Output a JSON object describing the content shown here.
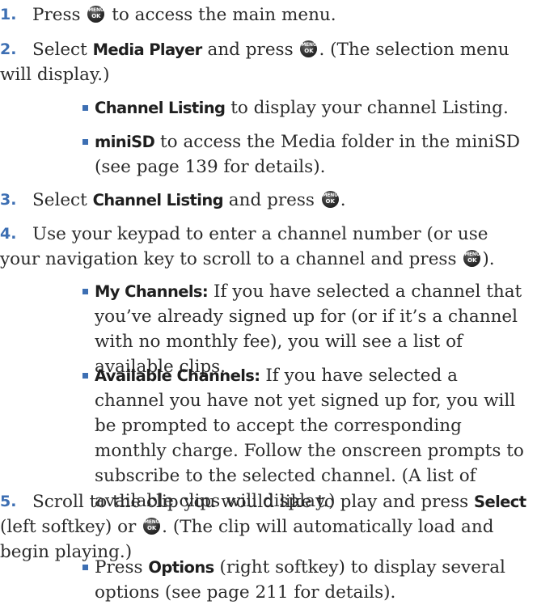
{
  "menu_key": {
    "top": "MENU",
    "bottom": "OK"
  },
  "steps": [
    {
      "num": "1.",
      "a": "Press ",
      "b": " to access the main menu."
    },
    {
      "num": "2.",
      "a": "Select ",
      "bold1": "Media Player",
      "b": " and press ",
      "c": ". (The selection menu will display.)"
    },
    {
      "num": "3.",
      "a": "Select ",
      "bold1": "Channel Listing",
      "b": " and press ",
      "c": "."
    },
    {
      "num": "4.",
      "a": "Use your keypad to enter a channel number (or use your navigation key to scroll to a channel and press ",
      "b": ")."
    },
    {
      "num": "5.",
      "a": "Scroll to the clip you would like to play and press ",
      "bold1": "Select",
      "b": " (left softkey) or ",
      "c": ". (The clip will automatically load and begin playing.)"
    }
  ],
  "bullets": [
    {
      "bold": "Channel Listing",
      "text": " to display your channel Listing."
    },
    {
      "bold": "miniSD",
      "text": " to access the Media folder in the miniSD (see page 139 for details)."
    },
    {
      "bold": "My Channels:",
      "text": " If you have selected a channel that you’ve already signed up for (or if it’s a channel with no monthly fee), you will see a list of available clips."
    },
    {
      "bold": "Available Channels:",
      "text": " If you have selected a channel you have not yet signed up for, you will be prompted to accept the corresponding monthly charge. Follow the onscreen prompts to subscribe to the selected channel. (A list of available clips will display.)"
    },
    {
      "pre": "Press ",
      "bold": "Options",
      "text": " (right softkey) to display several options (see page 211 for details)."
    }
  ]
}
